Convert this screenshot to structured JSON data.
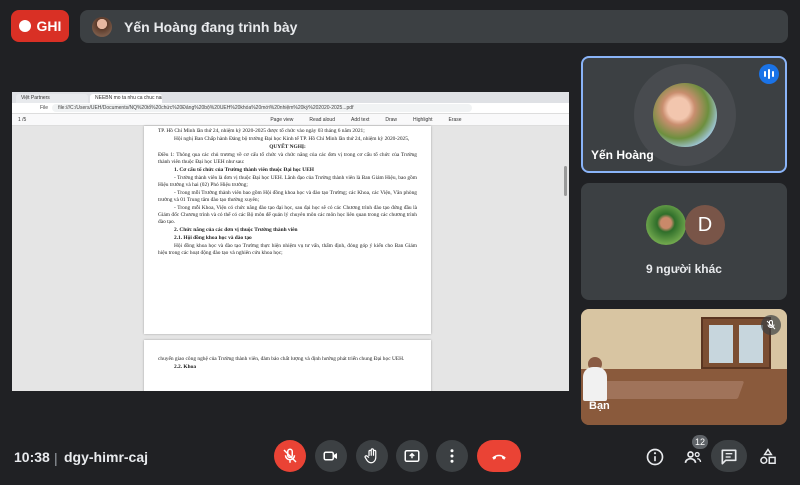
{
  "top": {
    "record_label": "GHI",
    "presenting_text": "Yến Hoàng đang trình bày"
  },
  "screen": {
    "tabs": [
      "Việt Partners",
      "NEEBN mo ta nhu ca chuc nang..."
    ],
    "url": "file:///C:/Users/UEH/Documents/NQ%20tổ%20chức%20Đảng%20bộ%20UEH%20khóa%20mới%20nhiệm%20kỳ%202020-2025...pdf",
    "pdf_toolbar": {
      "page": "1",
      "page_total": "/5",
      "page_view": "Page view",
      "read_aloud": "Read aloud",
      "add_text": "Add text",
      "draw": "Draw",
      "highlight": "Highlight",
      "erase": "Erase"
    },
    "page1": [
      "TP. Hồ Chí Minh lần thứ 24, nhiệm kỳ 2020-2025 được tổ chức vào ngày 03 tháng 6 năm 2021;",
      "Hội nghị Ban Chấp hành Đảng bộ trường Đại học Kinh tế TP. Hồ Chí Minh lần thứ 24, nhiệm kỳ 2020-2025,",
      "QUYẾT NGHỊ:",
      "Điều 1: Thông qua các chủ trương về cơ cấu tổ chức và chức năng của các đơn vị trong cơ cấu tổ chức của Trường thành viên thuộc Đại học UEH như sau:",
      "1. Cơ cấu tổ chức của Trường thành viên thuộc Đại học UEH",
      "- Trường thành viên là đơn vị thuộc Đại học UEH. Lãnh đạo của Trường thành viên là Ban Giám Hiệu, bao gồm Hiệu trưởng và hai (02) Phó Hiệu trưởng;",
      "- Trong mỗi Trường thành viên bao gồm Hội đồng khoa học và đào tạo Trường; các Khoa, các Viện, Văn phòng trường và 01 Trung tâm đào tạo thường xuyên;",
      "- Trong mỗi Khoa, Viện có chức năng đào tạo đại học, sau đại học sẽ có các Chương trình đào tạo đứng đầu là Giám đốc Chương trình và có thể có các Bộ môn để quản lý chuyên môn các môn học liên quan trong các chương trình đào tạo.",
      "2. Chức năng của các đơn vị thuộc Trường thành viên",
      "2.1. Hội đồng khoa học và đào tạo",
      "Hội đồng khoa học và đào tạo Trường thực hiện nhiệm vụ tư vấn, thẩm định, đóng góp ý kiến cho Ban Giám hiệu trong các hoạt động đào tạo và nghiên cứu khoa học;"
    ],
    "page2": [
      "chuyển giao công nghệ của Trường thành viên, đảm bảo chất lượng và định hướng phát triển chung Đại học UEH.",
      "2.2. Khoa"
    ]
  },
  "tiles": {
    "presenter_name": "Yến Hoàng",
    "others_label": "9 người khác",
    "others_initial": "D",
    "room_name": "Bạn"
  },
  "bottom": {
    "time": "10:38",
    "separator": "|",
    "meeting_code": "dgy-himr-caj",
    "participant_count": "12"
  },
  "colors": {
    "accent_red": "#ea4335",
    "record_red": "#d93025",
    "active_border": "#8ab4f8",
    "speaking_blue": "#1a73e8",
    "bar_grey": "#3c4043",
    "background": "#202124"
  },
  "icons": [
    "record-dot-icon",
    "mic-off-icon",
    "camera-icon",
    "raise-hand-icon",
    "present-icon",
    "more-options-icon",
    "end-call-icon",
    "info-icon",
    "people-icon",
    "chat-icon",
    "activities-icon",
    "speaking-icon"
  ]
}
